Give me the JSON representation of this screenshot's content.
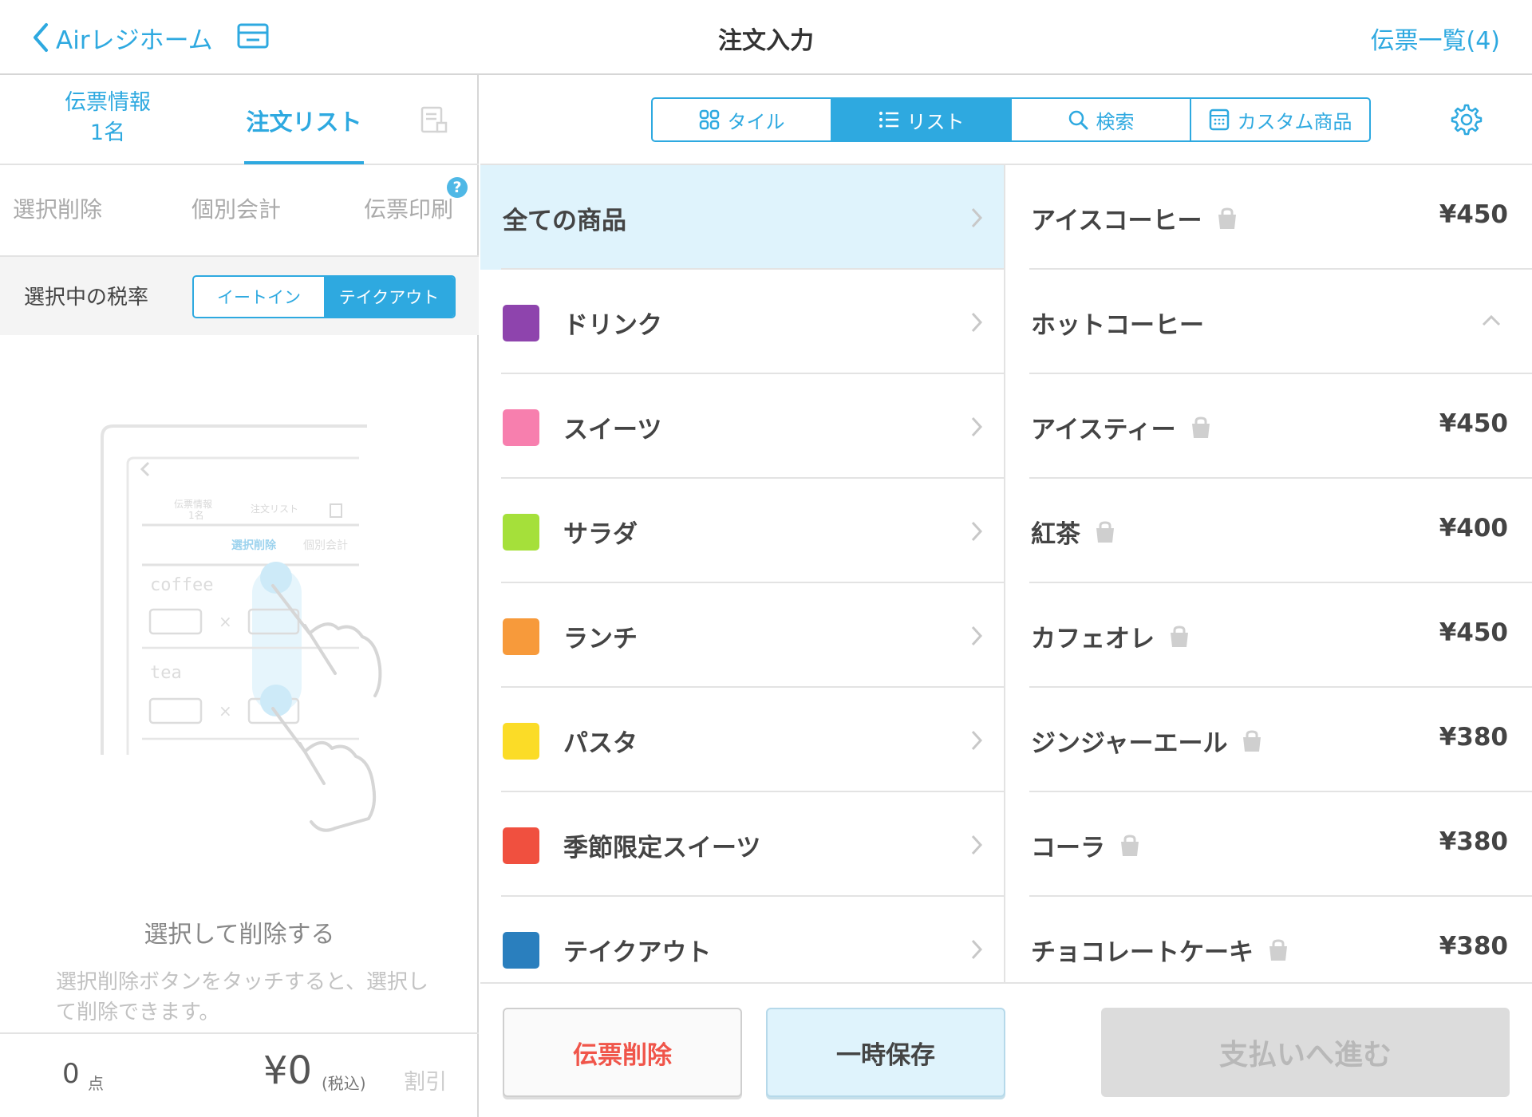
{
  "header": {
    "back_label": "Airレジホーム",
    "title": "注文入力",
    "slips_link": "伝票一覧(4)"
  },
  "left_tabs": {
    "info_line1": "伝票情報",
    "info_line2": "1名",
    "order_list": "注文リスト"
  },
  "actions": {
    "select_delete": "選択削除",
    "split_pay": "個別会計",
    "print_slip": "伝票印刷",
    "help_badge": "?"
  },
  "tax": {
    "label": "選択中の税率",
    "options": [
      "イートイン",
      "テイクアウト"
    ],
    "selected": "テイクアウト"
  },
  "empty_state": {
    "title": "選択して削除する",
    "description": "選択削除ボタンをタッチすると、選択して削除できます。"
  },
  "illustration": {
    "tab1_line1": "伝票情報",
    "tab1_line2": "1名",
    "tab2": "注文リスト",
    "action1": "選択削除",
    "action2": "個別会計",
    "item1": "coffee",
    "item2": "tea",
    "times": "×"
  },
  "footer": {
    "count": "0",
    "count_unit": "点",
    "total": "¥0",
    "tax_included": "(税込)",
    "discount": "割引"
  },
  "view_modes": {
    "tile": "タイル",
    "list": "リスト",
    "search": "検索",
    "custom": "カスタム商品",
    "selected": "リスト"
  },
  "categories": [
    {
      "label": "全ての商品",
      "color": "",
      "selected": true
    },
    {
      "label": "ドリンク",
      "color": "#8e44ad"
    },
    {
      "label": "スイーツ",
      "color": "#f77fae"
    },
    {
      "label": "サラダ",
      "color": "#a5e03a"
    },
    {
      "label": "ランチ",
      "color": "#f79a3b"
    },
    {
      "label": "パスタ",
      "color": "#fbdc27"
    },
    {
      "label": "季節限定スイーツ",
      "color": "#f0503f"
    },
    {
      "label": "テイクアウト",
      "color": "#2a7fbe"
    }
  ],
  "products": [
    {
      "name": "アイスコーヒー",
      "price": "¥450",
      "takeout_icon": "bag-icon"
    },
    {
      "name": "ホットコーヒー",
      "price": "",
      "expanded": true
    },
    {
      "name": "アイスティー",
      "price": "¥450",
      "takeout_icon": "bag-icon"
    },
    {
      "name": "紅茶",
      "price": "¥400",
      "takeout_icon": "bag-icon"
    },
    {
      "name": "カフェオレ",
      "price": "¥450",
      "takeout_icon": "bag-icon"
    },
    {
      "name": "ジンジャーエール",
      "price": "¥380",
      "takeout_icon": "bag-icon"
    },
    {
      "name": "コーラ",
      "price": "¥380",
      "takeout_icon": "bag-icon"
    },
    {
      "name": "チョコレートケーキ",
      "price": "¥380",
      "takeout_icon": "bag-icon"
    }
  ],
  "bottom_actions": {
    "delete_slip": "伝票削除",
    "hold": "一時保存",
    "proceed_payment": "支払いへ進む"
  },
  "colors": {
    "accent": "#2ea9e0",
    "danger": "#f0554a",
    "selected_bg": "#dff3fc"
  }
}
